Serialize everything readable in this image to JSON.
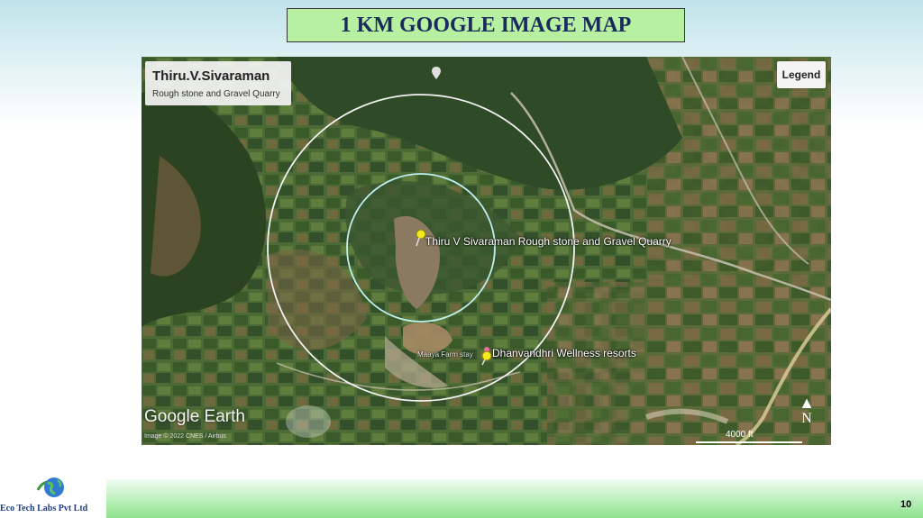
{
  "slide": {
    "title": "1 KM GOOGLE IMAGE MAP",
    "page_number": "10",
    "company": "Eco Tech Labs Pvt Ltd",
    "colors": {
      "title_bg": "#b7f0a0",
      "title_text": "#1a2a5c",
      "footer_band": "#8fe28f"
    }
  },
  "map": {
    "info_title": "Thiru.V.Sivaraman",
    "info_subtitle": "Rough stone and Gravel Quarry",
    "legend_label": "Legend",
    "markers": [
      {
        "label": "Thiru V Sivaraman Rough stone and Gravel Quarry",
        "icon": "yellow-pushpin-icon"
      },
      {
        "label": "Dhanvandhri Wellness resorts",
        "icon": "yellow-pushpin-icon"
      }
    ],
    "small_place_label": "Maaya Farm stay",
    "top_place_label": "",
    "branding": "Google Earth",
    "credit": "Image © 2022 CNES / Airbus",
    "scale": "4000 ft",
    "north": "N",
    "buffer_rings": [
      "white outer ring",
      "light-blue inner ring"
    ]
  }
}
